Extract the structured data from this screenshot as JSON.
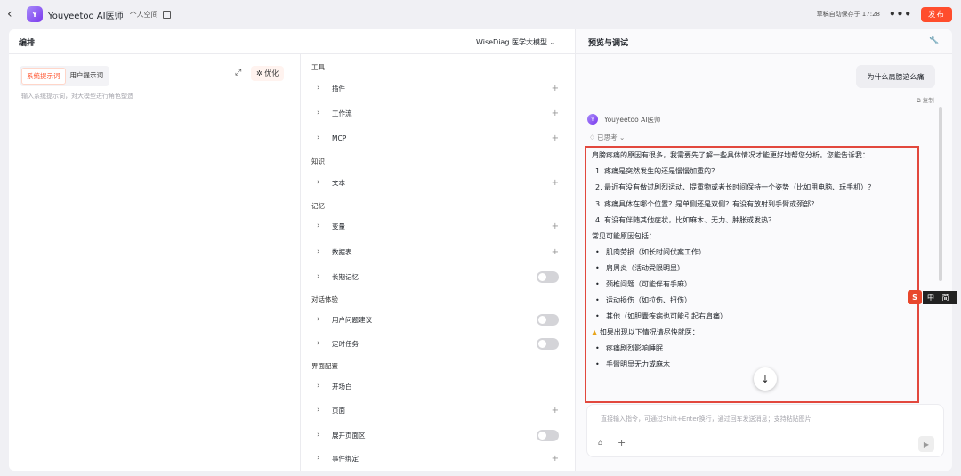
{
  "header": {
    "back_icon": "‹",
    "logo_letter": "Y",
    "app_title": "Youyeetoo AI医师",
    "space_label": "个人空间",
    "autosave": "草稿自动保存于 17:28",
    "more_icon": "•••",
    "publish_label": "发布"
  },
  "editor": {
    "title": "编排",
    "model": "WiseDiag 医学大模型",
    "tabs": [
      "系统提示词",
      "用户提示词"
    ],
    "optimize_label": "优化",
    "system_prompt_placeholder": "输入系统提示词，对大模型进行角色塑造"
  },
  "config": {
    "sections": {
      "tools": "工具",
      "knowledge": "知识",
      "memory": "记忆",
      "dialog": "对话体验",
      "ui": "界面配置"
    },
    "items": {
      "plugin": "插件",
      "workflow": "工作流",
      "mcp": "MCP",
      "text": "文本",
      "variable": "变量",
      "database": "数据表",
      "longterm": "长期记忆",
      "suggest": "用户问题建议",
      "schedule": "定时任务",
      "opening": "开场白",
      "page": "页面",
      "expand_page": "展开页面区",
      "event": "事件绑定"
    }
  },
  "preview": {
    "title": "预览与调试",
    "user_message": "为什么肩膀这么痛",
    "copy_label": "复制",
    "bot_name": "Youyeetoo AI医师",
    "thought_label": "已思考",
    "answer_intro": "肩膀疼痛的原因有很多，我需要先了解一些具体情况才能更好地帮您分析。您能告诉我：",
    "questions": [
      "1. 疼痛是突然发生的还是慢慢加重的？",
      "2. 最近有没有做过剧烈运动、提重物或者长时间保持一个姿势（比如用电脑、玩手机）？",
      "3. 疼痛具体在哪个位置？是单侧还是双侧？有没有放射到手臂或颈部？",
      "4. 有没有伴随其他症状，比如麻木、无力、肿胀或发热？"
    ],
    "causes_title": "常见可能原因包括：",
    "causes": [
      "肌肉劳损（如长时间伏案工作）",
      "肩周炎（活动受限明显）",
      "颈椎问题（可能伴有手麻）",
      "运动损伤（如拉伤、扭伤）",
      "其他（如胆囊疾病也可能引起右肩痛）"
    ],
    "warning_title": "如果出现以下情况请尽快就医：",
    "warnings": [
      "疼痛剧烈影响睡眠",
      "手臂明显无力或麻木"
    ],
    "input_placeholder": "直接输入指令，可通过Shift+Enter换行，通过回车发送消息；支持粘贴图片",
    "ime_labels": [
      "中",
      "简"
    ]
  }
}
